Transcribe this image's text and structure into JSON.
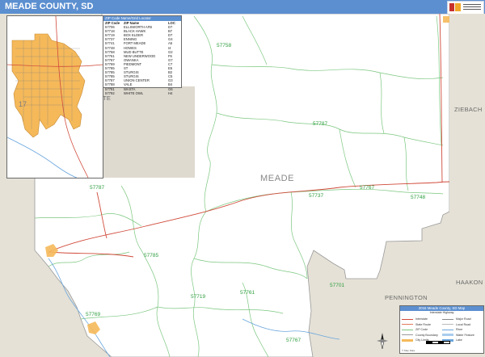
{
  "title": "MEADE COUNTY, SD",
  "colors": {
    "title_bar": "#5b8fd0",
    "county_fill": "#ffffff",
    "outside_fill": "#e5e1d6",
    "zip_boundary": "#7bc77f",
    "highway": "#d04a3a",
    "river": "#6aa6dd",
    "urban_fill": "#f5b95a"
  },
  "map_labels": {
    "county": "MEADE",
    "neighbors": {
      "ziebach": "ZIEBACH",
      "pennington": "PENNINGTON",
      "haakon": "HAAKON",
      "lawrence": "TE"
    }
  },
  "zip_labels": [
    {
      "text": "57758"
    },
    {
      "text": "57787"
    },
    {
      "text": "57787"
    },
    {
      "text": "57737"
    },
    {
      "text": "57767"
    },
    {
      "text": "57748"
    },
    {
      "text": "57785"
    },
    {
      "text": "57719"
    },
    {
      "text": "57761"
    },
    {
      "text": "57701"
    },
    {
      "text": "57769"
    },
    {
      "text": "57767"
    }
  ],
  "zip_table": {
    "title": "ZIP Code Name/Grid Locator",
    "headers": [
      "ZIP Code",
      "ZIP Name",
      "LOC"
    ],
    "rows": [
      [
        "57706",
        "ELLSWORTH AFB",
        "D7"
      ],
      [
        "57718",
        "BLACK HAWK",
        "B7"
      ],
      [
        "57719",
        "BOX ELDER",
        "D7"
      ],
      [
        "57737",
        "ENNING",
        "G4"
      ],
      [
        "57741",
        "FORT MEADE",
        "A5"
      ],
      [
        "57748",
        "HOWES",
        "I4"
      ],
      [
        "57758",
        "MUD BUTTE",
        "G2"
      ],
      [
        "57761",
        "NEW UNDERWOOD",
        "F6"
      ],
      [
        "57767",
        "OWANKA",
        "G7"
      ],
      [
        "57769",
        "PIEDMONT",
        "C7"
      ],
      [
        "57785",
        "ST",
        "E5"
      ],
      [
        "57785",
        "STURGIS",
        "B2"
      ],
      [
        "57785",
        "STURGIS",
        "C5"
      ],
      [
        "57787",
        "UNION CENTER",
        "G3"
      ],
      [
        "57788",
        "VALE",
        "B4"
      ],
      [
        "57791",
        "WASTA",
        "G6"
      ],
      [
        "57792",
        "WHITE OWL",
        "H4"
      ]
    ]
  },
  "legend": {
    "title": "2016 Meade County, SD Map",
    "subtitle": "Interstate Highway",
    "items_left": [
      "Interstate",
      "State Route",
      "ZIP Code",
      "County Boundary",
      "City Limits"
    ],
    "items_right": [
      "Major Road",
      "Local Road",
      "River",
      "Water Feature",
      "Lake"
    ],
    "note": "© Map Data"
  }
}
